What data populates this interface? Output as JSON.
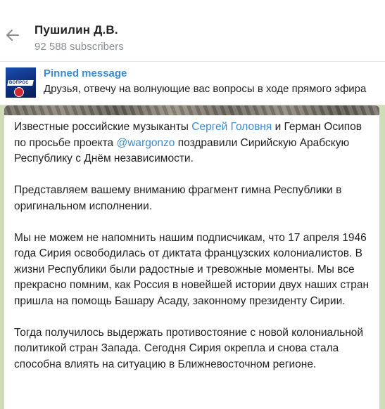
{
  "header": {
    "title": "Пушилин Д.В.",
    "subscribers": "92 588 subscribers"
  },
  "pinned": {
    "label": "Pinned message",
    "text": "Друзья, отвечу на волнующие вас вопросы в ходе прямого эфира",
    "thumb_text": "ВОПРОС"
  },
  "message": {
    "p1": {
      "before": "Известные российские музыканты ",
      "link1": "Сергей Головня",
      "middle": " и Герман Осипов по просьбе проекта ",
      "link2": "@wargonzo",
      "after": " поздравили Сирийскую Арабскую Республику с Днём независимости."
    },
    "p2": "Представляем вашему вниманию фрагмент гимна Республики в оригинальном исполнении.",
    "p3": "Мы не можем не напомнить нашим подписчикам, что 17 апреля 1946 года Сирия освободилась от диктата французских колониалистов. В жизни Республики были радостные и тревожные моменты. Мы все прекрасно помним, как Россия в новейшей истории двух наших стран пришла на помощь Башару Асаду, законному президенту Сирии.",
    "p4": "Тогда получилось выдержать противостояние с новой колониальной политикой стран Запада. Сегодня Сирия окрепла и снова стала способна влиять на ситуацию в Ближневосточном регионе."
  },
  "colors": {
    "accent": "#3a8bd1",
    "chat_background": "#cfdcb8"
  },
  "icons": {
    "back": "arrow-left-icon"
  }
}
